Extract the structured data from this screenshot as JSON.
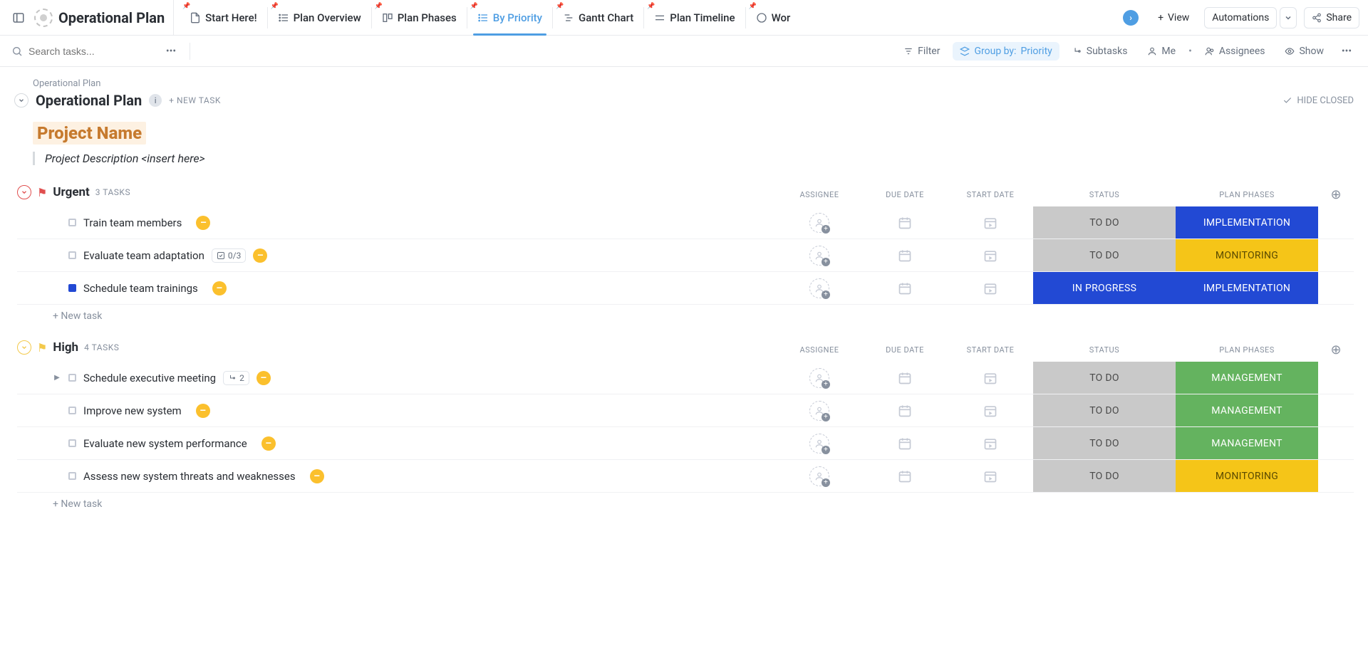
{
  "topbar": {
    "project_title": "Operational Plan",
    "tabs": [
      {
        "label": "Start Here!"
      },
      {
        "label": "Plan Overview"
      },
      {
        "label": "Plan Phases"
      },
      {
        "label": "By Priority",
        "active": true
      },
      {
        "label": "Gantt Chart"
      },
      {
        "label": "Plan Timeline"
      },
      {
        "label": "Wor"
      }
    ],
    "view_btn": "View",
    "automations": "Automations",
    "share": "Share"
  },
  "toolbar": {
    "search_placeholder": "Search tasks...",
    "filter": "Filter",
    "group_by_label": "Group by:",
    "group_by_value": "Priority",
    "subtasks": "Subtasks",
    "me": "Me",
    "assignees": "Assignees",
    "show": "Show"
  },
  "list": {
    "breadcrumb": "Operational Plan",
    "title": "Operational Plan",
    "new_task": "+ NEW TASK",
    "hide_closed": "HIDE CLOSED",
    "project_name": "Project Name",
    "project_desc": "Project Description <insert here>"
  },
  "columns": {
    "assignee": "ASSIGNEE",
    "due_date": "DUE DATE",
    "start_date": "START DATE",
    "status": "STATUS",
    "plan_phases": "PLAN PHASES"
  },
  "groups": [
    {
      "name": "Urgent",
      "priority": "urgent",
      "count": "3 TASKS",
      "tasks": [
        {
          "name": "Train team members",
          "status_label": "TO DO",
          "status_class": "",
          "phase": "IMPLEMENTATION",
          "phase_class": "implementation",
          "dot": "",
          "subtask": "",
          "subtask_count": "",
          "expand": ""
        },
        {
          "name": "Evaluate team adaptation",
          "status_label": "TO DO",
          "status_class": "",
          "phase": "MONITORING",
          "phase_class": "monitoring",
          "dot": "",
          "subtask": "checklist",
          "subtask_count": "0/3",
          "expand": ""
        },
        {
          "name": "Schedule team trainings",
          "status_label": "IN PROGRESS",
          "status_class": "inprog",
          "phase": "IMPLEMENTATION",
          "phase_class": "implementation",
          "dot": "inprog",
          "subtask": "",
          "subtask_count": "",
          "expand": ""
        }
      ]
    },
    {
      "name": "High",
      "priority": "high",
      "count": "4 TASKS",
      "tasks": [
        {
          "name": "Schedule executive meeting",
          "status_label": "TO DO",
          "status_class": "",
          "phase": "MANAGEMENT",
          "phase_class": "management",
          "dot": "",
          "subtask": "subtask",
          "subtask_count": "2",
          "expand": "▶"
        },
        {
          "name": "Improve new system",
          "status_label": "TO DO",
          "status_class": "",
          "phase": "MANAGEMENT",
          "phase_class": "management",
          "dot": "",
          "subtask": "",
          "subtask_count": "",
          "expand": ""
        },
        {
          "name": "Evaluate new system performance",
          "status_label": "TO DO",
          "status_class": "",
          "phase": "MANAGEMENT",
          "phase_class": "management",
          "dot": "",
          "subtask": "",
          "subtask_count": "",
          "expand": ""
        },
        {
          "name": "Assess new system threats and weaknesses",
          "status_label": "TO DO",
          "status_class": "",
          "phase": "MONITORING",
          "phase_class": "monitoring",
          "dot": "",
          "subtask": "",
          "subtask_count": "",
          "expand": ""
        }
      ]
    }
  ],
  "new_task_row": "+ New task"
}
